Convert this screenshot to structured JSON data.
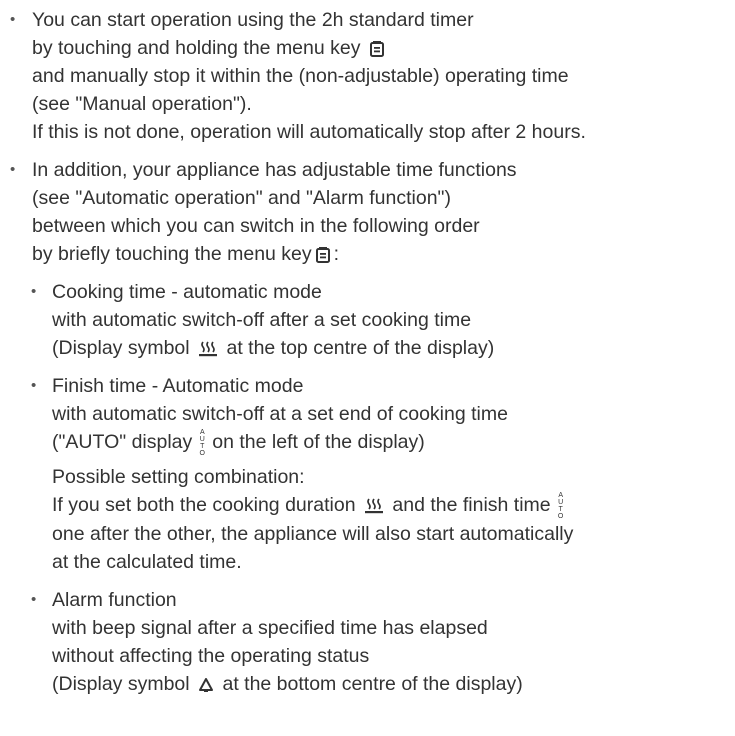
{
  "item1": {
    "line1": "You can start operation using the 2h standard timer",
    "line2_pre": "by touching and holding the menu key",
    "line3": "and manually stop it within the (non-adjustable) operating time",
    "line4": "(see \"Manual operation\").",
    "line5": "If this is not done, operation will automatically stop after 2 hours."
  },
  "item2": {
    "line1": "In addition, your appliance has adjustable time functions",
    "line2": "(see \"Automatic operation\" and \"Alarm function\")",
    "line3": "between which you can switch in the following order",
    "line4_pre": "by briefly touching the menu key",
    "line4_post": ":"
  },
  "sub1": {
    "line1": "Cooking time - automatic mode",
    "line2": "with automatic switch-off after a set cooking time",
    "line3_pre": "(Display symbol",
    "line3_post": "at the top centre of the display)"
  },
  "sub2": {
    "line1": "Finish time - Automatic mode",
    "line2": "with automatic switch-off at a set end of cooking time",
    "line3_pre": "(\"AUTO\" display",
    "line3_post": "on the left of the display)",
    "p2_line1": "Possible setting combination:",
    "p2_line2_pre": "If you set both the cooking duration",
    "p2_line2_mid": "and the finish time",
    "p2_line3": "one after the other, the appliance will also start automatically",
    "p2_line4": "at the calculated time."
  },
  "sub3": {
    "line1": "Alarm function",
    "line2": "with beep signal after a specified time has elapsed",
    "line3": "without affecting the operating status",
    "line4_pre": "(Display symbol",
    "line4_post": "at the bottom centre of the display)"
  },
  "icons": {
    "menu_key": "menu-key-icon",
    "cooking_time": "steam-pot-icon",
    "auto": "auto-icon",
    "alarm": "bell-icon"
  },
  "auto_glyph": {
    "a": "A",
    "u": "U",
    "t": "T",
    "o": "O"
  },
  "bullet_char": "•"
}
